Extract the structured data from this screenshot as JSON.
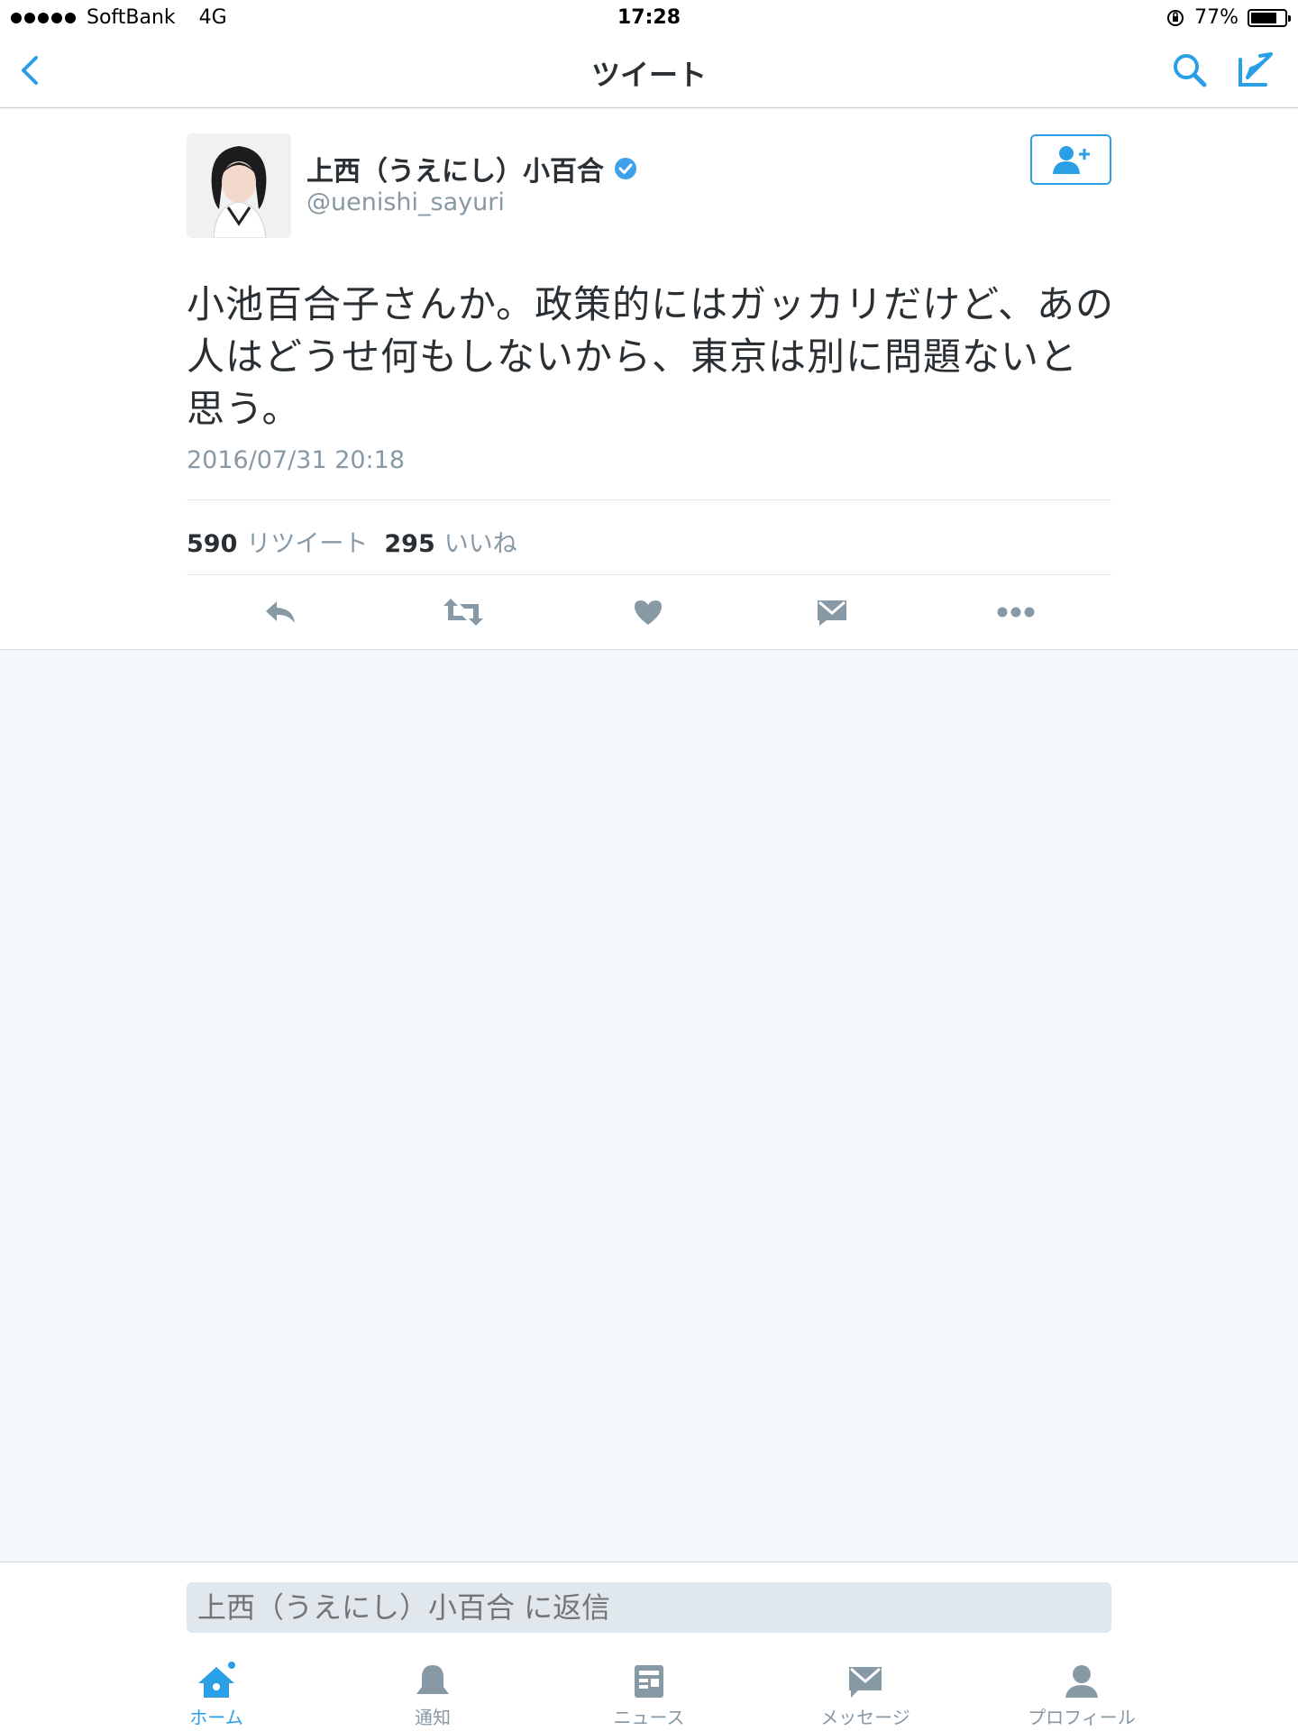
{
  "status_bar": {
    "carrier": "SoftBank",
    "network": "4G",
    "time": "17:28",
    "battery": "77%",
    "battery_level": 0.77
  },
  "nav": {
    "title": "ツイート",
    "back_icon": "chevron-left-icon",
    "search_icon": "search-icon",
    "compose_icon": "compose-icon"
  },
  "tweet": {
    "author_name": "上西（うえにし）小百合",
    "author_handle": "@uenishi_sayuri",
    "verified": true,
    "text": "小池百合子さんか。政策的にはガッカリだけど、あの人はどうせ何もしないから、東京は別に問題ないと思う。",
    "timestamp": "2016/07/31 20:18",
    "retweet_count": "590",
    "retweet_label": "リツイート",
    "like_count": "295",
    "like_label": "いいね"
  },
  "reply": {
    "placeholder": "上西（うえにし）小百合 に返信"
  },
  "tabs": [
    {
      "label": "ホーム",
      "icon": "home-icon",
      "active": true
    },
    {
      "label": "通知",
      "icon": "bell-icon",
      "active": false
    },
    {
      "label": "ニュース",
      "icon": "news-icon",
      "active": false
    },
    {
      "label": "メッセージ",
      "icon": "envelope-icon",
      "active": false
    },
    {
      "label": "プロフィール",
      "icon": "person-icon",
      "active": false
    }
  ],
  "colors": {
    "accent": "#2b9fe6",
    "muted": "#8899a6",
    "background": "#f5f8fa"
  }
}
